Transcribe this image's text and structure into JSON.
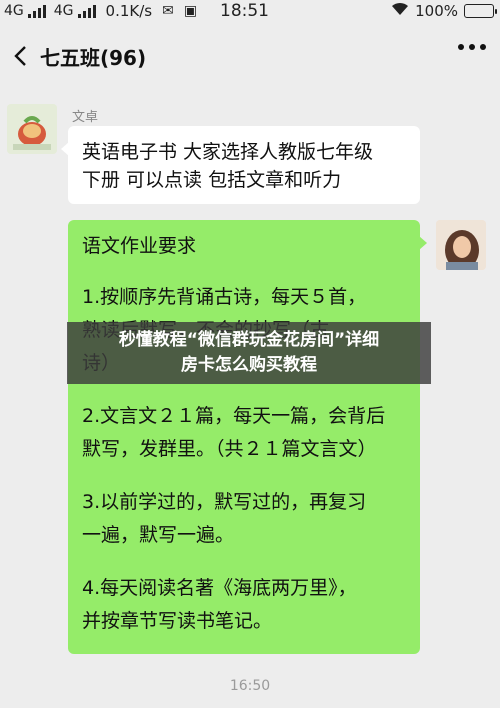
{
  "status_bar": {
    "network1": "4G",
    "network2": "4G",
    "speed": "0.1K/s",
    "time": "18:51",
    "battery": "100%",
    "battery_level": 1.0,
    "icons": [
      "notification-icon",
      "image-icon",
      "wifi-icon"
    ]
  },
  "header": {
    "title": "七五班(96)",
    "back_icon": "chevron-left-icon",
    "more_icon": "more-dots-icon"
  },
  "messages": [
    {
      "sender": "文卓",
      "side": "left",
      "lines": [
        "英语电子书 大家选择人教版七年级",
        "下册 可以点读 包括文章和听力"
      ]
    },
    {
      "side": "right",
      "paragraphs": [
        [
          "语文作业要求"
        ],
        [
          "1.按顺序先背诵古诗，每天５首，",
          "熟读后默写，不会的抄写（古",
          "诗）"
        ],
        [
          "2.文言文２１篇，每天一篇，会背后",
          "默写，发群里。（共２１篇文言文）"
        ],
        [
          "3.以前学过的，默写过的，再复习",
          "一遍，默写一遍。"
        ],
        [
          "4.每天阅读名著《海底两万里》，",
          "并按章节写读书笔记。"
        ]
      ]
    }
  ],
  "timestamp": "16:50",
  "overlay": {
    "line1": "秒懂教程“微信群玩金花房间”详细",
    "line2": "房卡怎么购买教程"
  },
  "colors": {
    "background": "#ededed",
    "bubble_self": "#95ec69",
    "bubble_other": "#ffffff"
  }
}
